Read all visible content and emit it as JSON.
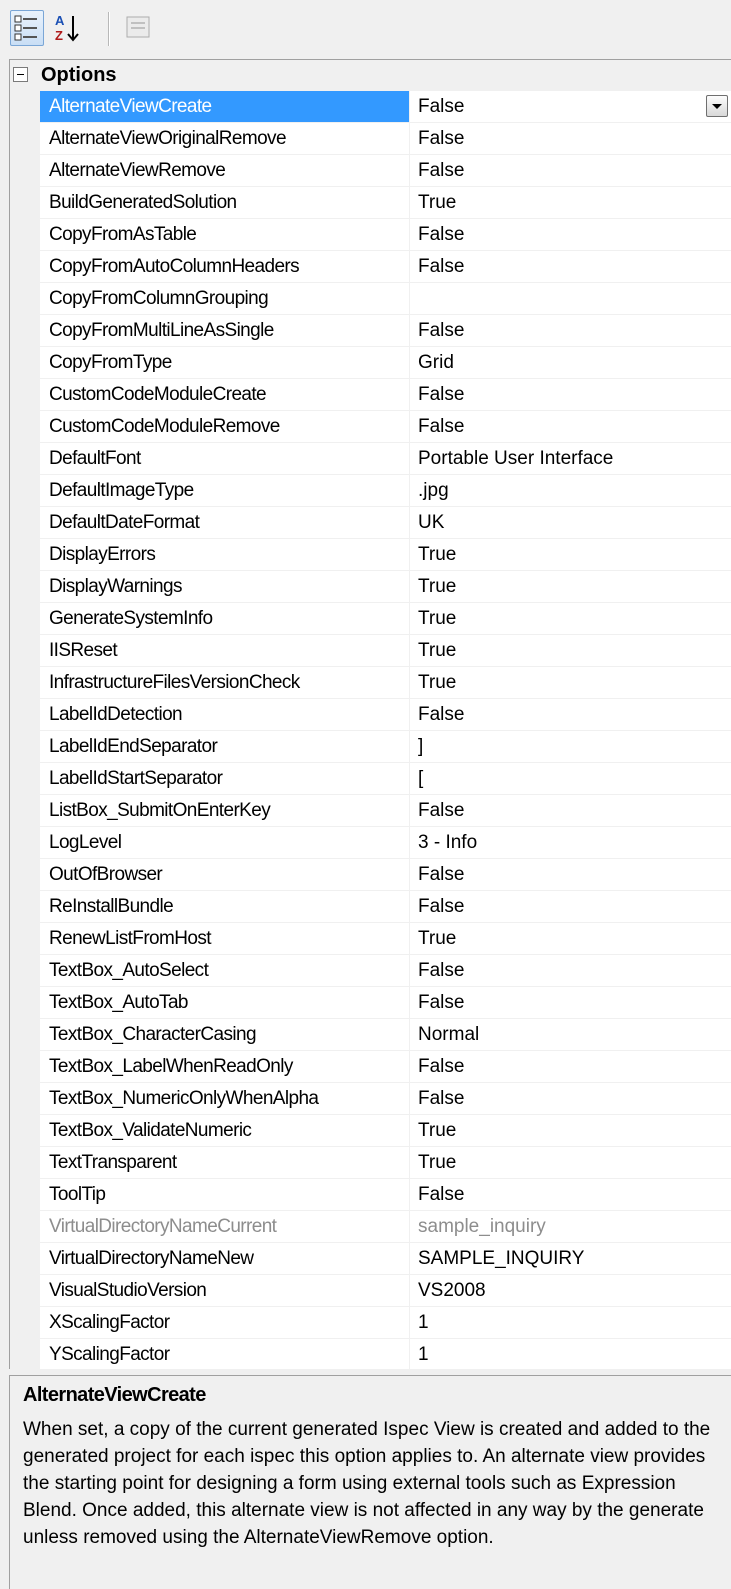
{
  "toolbar": {
    "categorized_icon": "categorized-icon",
    "alphabetical_icon": "sort-alphabetical-icon",
    "property_pages_icon": "property-pages-icon"
  },
  "category": {
    "title": "Options",
    "expanded": true
  },
  "selected_index": 0,
  "properties": [
    {
      "name": "AlternateViewCreate",
      "value": "False"
    },
    {
      "name": "AlternateViewOriginalRemove",
      "value": "False"
    },
    {
      "name": "AlternateViewRemove",
      "value": "False"
    },
    {
      "name": "BuildGeneratedSolution",
      "value": "True"
    },
    {
      "name": "CopyFromAsTable",
      "value": "False"
    },
    {
      "name": "CopyFromAutoColumnHeaders",
      "value": "False"
    },
    {
      "name": "CopyFromColumnGrouping",
      "value": ""
    },
    {
      "name": "CopyFromMultiLineAsSingle",
      "value": "False"
    },
    {
      "name": "CopyFromType",
      "value": "Grid"
    },
    {
      "name": "CustomCodeModuleCreate",
      "value": "False"
    },
    {
      "name": "CustomCodeModuleRemove",
      "value": "False"
    },
    {
      "name": "DefaultFont",
      "value": "Portable User Interface"
    },
    {
      "name": "DefaultImageType",
      "value": ".jpg"
    },
    {
      "name": "DefaultDateFormat",
      "value": "UK"
    },
    {
      "name": "DisplayErrors",
      "value": "True"
    },
    {
      "name": "DisplayWarnings",
      "value": "True"
    },
    {
      "name": "GenerateSystemInfo",
      "value": "True"
    },
    {
      "name": "IISReset",
      "value": "True"
    },
    {
      "name": "InfrastructureFilesVersionCheck",
      "value": "True"
    },
    {
      "name": "LabelIdDetection",
      "value": "False"
    },
    {
      "name": "LabelIdEndSeparator",
      "value": "]"
    },
    {
      "name": "LabelIdStartSeparator",
      "value": "["
    },
    {
      "name": "ListBox_SubmitOnEnterKey",
      "value": "False"
    },
    {
      "name": "LogLevel",
      "value": "3 - Info"
    },
    {
      "name": "OutOfBrowser",
      "value": "False"
    },
    {
      "name": "ReInstallBundle",
      "value": "False"
    },
    {
      "name": "RenewListFromHost",
      "value": "True"
    },
    {
      "name": "TextBox_AutoSelect",
      "value": "False"
    },
    {
      "name": "TextBox_AutoTab",
      "value": "False"
    },
    {
      "name": "TextBox_CharacterCasing",
      "value": "Normal"
    },
    {
      "name": "TextBox_LabelWhenReadOnly",
      "value": "False"
    },
    {
      "name": "TextBox_NumericOnlyWhenAlpha",
      "value": "False"
    },
    {
      "name": "TextBox_ValidateNumeric",
      "value": "True"
    },
    {
      "name": "TextTransparent",
      "value": "True"
    },
    {
      "name": "ToolTip",
      "value": "False"
    },
    {
      "name": "VirtualDirectoryNameCurrent",
      "value": "sample_inquiry",
      "disabled": true
    },
    {
      "name": "VirtualDirectoryNameNew",
      "value": "SAMPLE_INQUIRY"
    },
    {
      "name": "VisualStudioVersion",
      "value": "VS2008"
    },
    {
      "name": "XScalingFactor",
      "value": "1"
    },
    {
      "name": "YScalingFactor",
      "value": "1"
    }
  ],
  "description": {
    "title": "AlternateViewCreate",
    "text": "When set, a copy of the current generated Ispec View is created and added to the generated project for each ispec this option applies to. An alternate view provides the starting point for designing a form using external tools such as Expression Blend. Once added, this alternate view is not affected in any way by the generate unless removed using the AlternateViewRemove option."
  },
  "colors": {
    "selection": "#3399ff",
    "panel": "#f0f0f0",
    "disabled_text": "#8d8d8d"
  }
}
